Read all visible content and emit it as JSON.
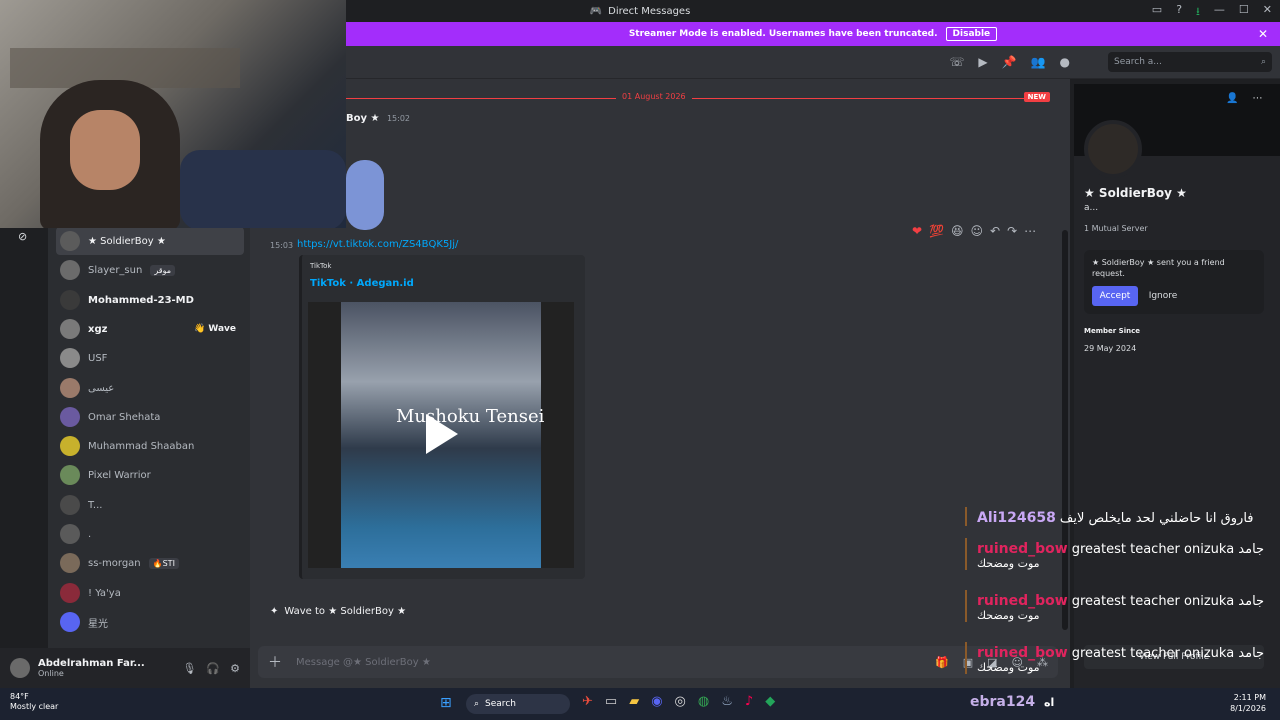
{
  "window": {
    "title": "Direct Messages"
  },
  "banner": {
    "text": "Streamer Mode is enabled. Usernames have been truncated.",
    "disable_label": "Disable"
  },
  "header": {
    "search_placeholder": "Search a..."
  },
  "dm_list": [
    {
      "name": "★ SoldierBoy ★",
      "active": true,
      "badge": "",
      "color": "#5b5b5b"
    },
    {
      "name": "Slayer_sun",
      "active": false,
      "badge": "موقر",
      "color": "#6b6b6b"
    },
    {
      "name": "Mohammed-23-MD",
      "active": false,
      "bold": true,
      "badge": "",
      "color": "#3a3a3a"
    },
    {
      "name": "xgz",
      "active": false,
      "bold": true,
      "badge": "",
      "wave": "👋 Wave",
      "color": "#7a7a7a"
    },
    {
      "name": "USF",
      "active": false,
      "badge": "",
      "color": "#8a8a8a"
    },
    {
      "name": "عيسى",
      "active": false,
      "badge": "",
      "color": "#9a7a6a"
    },
    {
      "name": "Omar Shehata",
      "active": false,
      "badge": "",
      "color": "#6a5aa0"
    },
    {
      "name": "Muhammad Shaaban",
      "active": false,
      "badge": "",
      "color": "#c7b12c"
    },
    {
      "name": "Pixel Warrior",
      "active": false,
      "badge": "",
      "color": "#6a8a5a"
    },
    {
      "name": "T...",
      "active": false,
      "badge": "",
      "color": "#4a4a4a"
    },
    {
      "name": ".",
      "active": false,
      "badge": "",
      "color": "#5a5a5a"
    },
    {
      "name": "ss-morgan",
      "active": false,
      "badge": "🔥STI",
      "color": "#7a6a5a"
    },
    {
      "name": "! Ya'ya",
      "active": false,
      "badge": "",
      "color": "#8a2a3a"
    },
    {
      "name": "星光",
      "active": false,
      "badge": "",
      "color": "#5865f2"
    }
  ],
  "user_panel": {
    "name": "Abdelrahman Far...",
    "status": "Online"
  },
  "chat": {
    "date_divider": "01 August 2026",
    "new_badge": "NEW",
    "author": "Boy ★",
    "author_time": "15:02",
    "msg_time": "15:03",
    "link": "https://vt.tiktok.com/ZS4BQK5Jj/",
    "embed_provider": "TikTok",
    "embed_title": "TikTok · Adegan.id",
    "video_logo": "Mushoku Tensei",
    "wave_label": "Wave to ★ SoldierBoy ★",
    "composer_placeholder": "Message @★ SoldierBoy ★"
  },
  "profile": {
    "name": "★ SoldierBoy ★",
    "sub": "a...",
    "mutual": "1 Mutual Server",
    "friend_request": "★ SoldierBoy ★ sent you a friend request.",
    "accept_label": "Accept",
    "ignore_label": "Ignore",
    "member_since_label": "Member Since",
    "member_since": "29 May 2024",
    "view_full_profile": "View Full Profile"
  },
  "stream_chat": [
    {
      "user": "Ali124658",
      "user_color": "#c9a8f5",
      "msg": "فاروق انا حاضلني لحد مايخلص لايف",
      "sub": ""
    },
    {
      "user": "ruined_bow",
      "user_color": "#e0245e",
      "msg": "greatest teacher onizuka جامد",
      "sub": "موت ومضحك"
    },
    {
      "user": "ruined_bow",
      "user_color": "#e0245e",
      "msg": "greatest teacher onizuka جامد",
      "sub": "موت ومضحك"
    },
    {
      "user": "ruined_bow",
      "user_color": "#e0245e",
      "msg": "greatest teacher onizuka جامد",
      "sub": "موت ومضحك"
    }
  ],
  "taskbar": {
    "temp": "84°F",
    "weather": "Mostly clear",
    "search_label": "Search",
    "time": "2:11 PM",
    "date": "8/1/2026",
    "overlay_user": "ebra124",
    "overlay_msg": "اه"
  },
  "colors": {
    "accent": "#5865f2",
    "banner": "#a32dfb",
    "danger": "#f23f43",
    "link": "#00a8fc"
  }
}
